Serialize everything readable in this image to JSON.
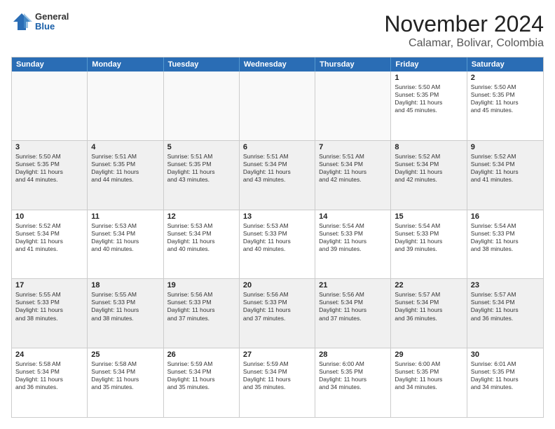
{
  "logo": {
    "general": "General",
    "blue": "Blue"
  },
  "title": "November 2024",
  "location": "Calamar, Bolivar, Colombia",
  "header": {
    "days": [
      "Sunday",
      "Monday",
      "Tuesday",
      "Wednesday",
      "Thursday",
      "Friday",
      "Saturday"
    ]
  },
  "weeks": [
    [
      {
        "day": "",
        "info": ""
      },
      {
        "day": "",
        "info": ""
      },
      {
        "day": "",
        "info": ""
      },
      {
        "day": "",
        "info": ""
      },
      {
        "day": "",
        "info": ""
      },
      {
        "day": "1",
        "info": "Sunrise: 5:50 AM\nSunset: 5:35 PM\nDaylight: 11 hours\nand 45 minutes."
      },
      {
        "day": "2",
        "info": "Sunrise: 5:50 AM\nSunset: 5:35 PM\nDaylight: 11 hours\nand 45 minutes."
      }
    ],
    [
      {
        "day": "3",
        "info": "Sunrise: 5:50 AM\nSunset: 5:35 PM\nDaylight: 11 hours\nand 44 minutes."
      },
      {
        "day": "4",
        "info": "Sunrise: 5:51 AM\nSunset: 5:35 PM\nDaylight: 11 hours\nand 44 minutes."
      },
      {
        "day": "5",
        "info": "Sunrise: 5:51 AM\nSunset: 5:35 PM\nDaylight: 11 hours\nand 43 minutes."
      },
      {
        "day": "6",
        "info": "Sunrise: 5:51 AM\nSunset: 5:34 PM\nDaylight: 11 hours\nand 43 minutes."
      },
      {
        "day": "7",
        "info": "Sunrise: 5:51 AM\nSunset: 5:34 PM\nDaylight: 11 hours\nand 42 minutes."
      },
      {
        "day": "8",
        "info": "Sunrise: 5:52 AM\nSunset: 5:34 PM\nDaylight: 11 hours\nand 42 minutes."
      },
      {
        "day": "9",
        "info": "Sunrise: 5:52 AM\nSunset: 5:34 PM\nDaylight: 11 hours\nand 41 minutes."
      }
    ],
    [
      {
        "day": "10",
        "info": "Sunrise: 5:52 AM\nSunset: 5:34 PM\nDaylight: 11 hours\nand 41 minutes."
      },
      {
        "day": "11",
        "info": "Sunrise: 5:53 AM\nSunset: 5:34 PM\nDaylight: 11 hours\nand 40 minutes."
      },
      {
        "day": "12",
        "info": "Sunrise: 5:53 AM\nSunset: 5:34 PM\nDaylight: 11 hours\nand 40 minutes."
      },
      {
        "day": "13",
        "info": "Sunrise: 5:53 AM\nSunset: 5:33 PM\nDaylight: 11 hours\nand 40 minutes."
      },
      {
        "day": "14",
        "info": "Sunrise: 5:54 AM\nSunset: 5:33 PM\nDaylight: 11 hours\nand 39 minutes."
      },
      {
        "day": "15",
        "info": "Sunrise: 5:54 AM\nSunset: 5:33 PM\nDaylight: 11 hours\nand 39 minutes."
      },
      {
        "day": "16",
        "info": "Sunrise: 5:54 AM\nSunset: 5:33 PM\nDaylight: 11 hours\nand 38 minutes."
      }
    ],
    [
      {
        "day": "17",
        "info": "Sunrise: 5:55 AM\nSunset: 5:33 PM\nDaylight: 11 hours\nand 38 minutes."
      },
      {
        "day": "18",
        "info": "Sunrise: 5:55 AM\nSunset: 5:33 PM\nDaylight: 11 hours\nand 38 minutes."
      },
      {
        "day": "19",
        "info": "Sunrise: 5:56 AM\nSunset: 5:33 PM\nDaylight: 11 hours\nand 37 minutes."
      },
      {
        "day": "20",
        "info": "Sunrise: 5:56 AM\nSunset: 5:33 PM\nDaylight: 11 hours\nand 37 minutes."
      },
      {
        "day": "21",
        "info": "Sunrise: 5:56 AM\nSunset: 5:34 PM\nDaylight: 11 hours\nand 37 minutes."
      },
      {
        "day": "22",
        "info": "Sunrise: 5:57 AM\nSunset: 5:34 PM\nDaylight: 11 hours\nand 36 minutes."
      },
      {
        "day": "23",
        "info": "Sunrise: 5:57 AM\nSunset: 5:34 PM\nDaylight: 11 hours\nand 36 minutes."
      }
    ],
    [
      {
        "day": "24",
        "info": "Sunrise: 5:58 AM\nSunset: 5:34 PM\nDaylight: 11 hours\nand 36 minutes."
      },
      {
        "day": "25",
        "info": "Sunrise: 5:58 AM\nSunset: 5:34 PM\nDaylight: 11 hours\nand 35 minutes."
      },
      {
        "day": "26",
        "info": "Sunrise: 5:59 AM\nSunset: 5:34 PM\nDaylight: 11 hours\nand 35 minutes."
      },
      {
        "day": "27",
        "info": "Sunrise: 5:59 AM\nSunset: 5:34 PM\nDaylight: 11 hours\nand 35 minutes."
      },
      {
        "day": "28",
        "info": "Sunrise: 6:00 AM\nSunset: 5:35 PM\nDaylight: 11 hours\nand 34 minutes."
      },
      {
        "day": "29",
        "info": "Sunrise: 6:00 AM\nSunset: 5:35 PM\nDaylight: 11 hours\nand 34 minutes."
      },
      {
        "day": "30",
        "info": "Sunrise: 6:01 AM\nSunset: 5:35 PM\nDaylight: 11 hours\nand 34 minutes."
      }
    ]
  ]
}
